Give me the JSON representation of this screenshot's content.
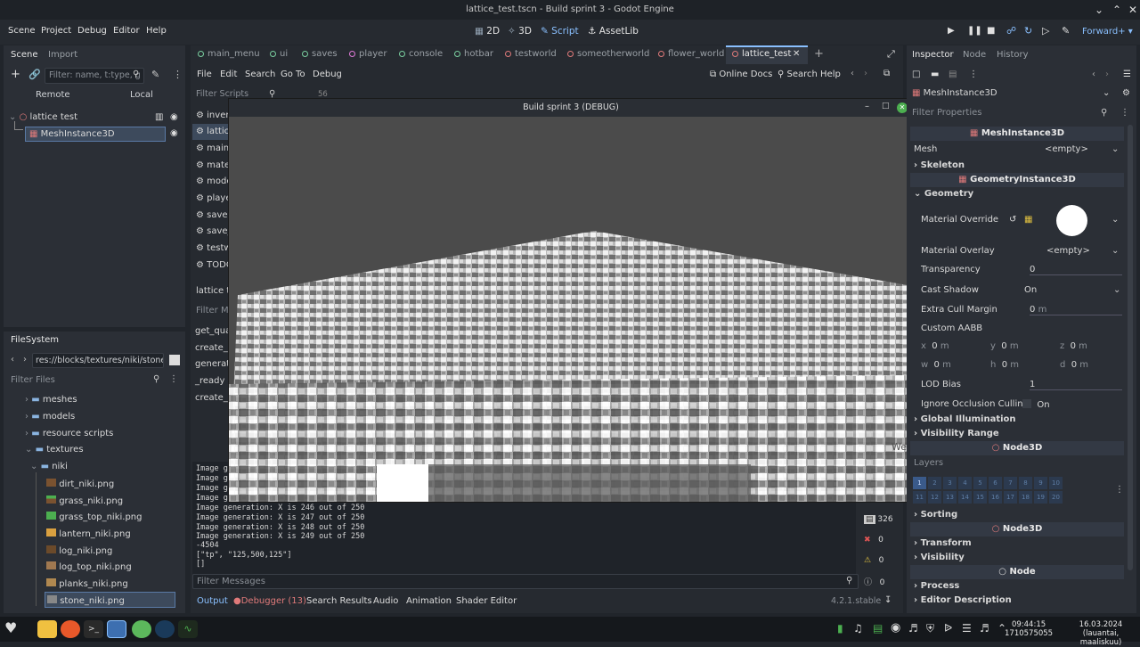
{
  "window": {
    "title": "lattice_test.tscn - Build sprint 3 - Godot Engine"
  },
  "menu": [
    "Scene",
    "Project",
    "Debug",
    "Editor",
    "Help"
  ],
  "workspaces": {
    "w2d": "2D",
    "w3d": "3D",
    "script": "Script",
    "assetlib": "AssetLib"
  },
  "renderer": "Forward+",
  "scene_tabs": [
    {
      "label": "main_menu",
      "color": "#7ad0a0"
    },
    {
      "label": "ui",
      "color": "#7ad0a0"
    },
    {
      "label": "saves",
      "color": "#7ad0a0"
    },
    {
      "label": "player",
      "color": "#e07ad8"
    },
    {
      "label": "console",
      "color": "#7ad0a0"
    },
    {
      "label": "hotbar",
      "color": "#7ad0a0"
    },
    {
      "label": "testworld",
      "color": "#e07a7a"
    },
    {
      "label": "someotherworld",
      "color": "#e07a7a"
    },
    {
      "label": "flower_world",
      "color": "#e07a7a"
    },
    {
      "label": "lattice_test",
      "color": "#e07a7a"
    }
  ],
  "scene_dock": {
    "tab_scene": "Scene",
    "tab_import": "Import",
    "filter_placeholder": "Filter: name, t:type, g",
    "remote": "Remote",
    "local": "Local",
    "root": "lattice test",
    "child": "MeshInstance3D"
  },
  "filesystem": {
    "tab": "FileSystem",
    "path": "res://blocks/textures/niki/stone_",
    "filter_placeholder": "Filter Files",
    "items": [
      {
        "label": "meshes",
        "type": "folder"
      },
      {
        "label": "models",
        "type": "folder"
      },
      {
        "label": "resource scripts",
        "type": "folder"
      },
      {
        "label": "textures",
        "type": "folder"
      },
      {
        "label": "niki",
        "type": "folder"
      },
      {
        "label": "dirt_niki.png",
        "type": "file"
      },
      {
        "label": "grass_niki.png",
        "type": "file"
      },
      {
        "label": "grass_top_niki.png",
        "type": "file"
      },
      {
        "label": "lantern_niki.png",
        "type": "file"
      },
      {
        "label": "log_niki.png",
        "type": "file"
      },
      {
        "label": "log_top_niki.png",
        "type": "file"
      },
      {
        "label": "planks_niki.png",
        "type": "file"
      },
      {
        "label": "stone_niki.png",
        "type": "file"
      }
    ]
  },
  "script_editor": {
    "menu": [
      "File",
      "Edit",
      "Search",
      "Go To",
      "Debug"
    ],
    "online_docs": "Online Docs",
    "search_help": "Search Help",
    "filter_scripts": "Filter Scripts",
    "line_no": "56",
    "scripts": [
      "inver",
      "lattic",
      "main",
      "mate",
      "mode",
      "playe",
      "saves",
      "save_",
      "testw",
      "TODO"
    ],
    "current": "lattice te",
    "filter_methods": "Filter M",
    "methods": [
      "get_qua",
      "create_l",
      "generat",
      "_ready",
      "create_v"
    ]
  },
  "output": {
    "lines": [
      "Image ge",
      "Image ge",
      "Image ge",
      "Image ge",
      "Image generation: X is 246 out of 250",
      "Image generation: X is 247 out of 250",
      "Image generation: X is 248 out of 250",
      "Image generation: X is 249 out of 250",
      "-4504",
      "[\"tp\", \"125,500,125\"]",
      "[]"
    ],
    "filter_placeholder": "Filter Messages",
    "counts": {
      "messages": "326",
      "errors": "0",
      "warnings": "0",
      "info": "0"
    }
  },
  "bottom_tabs": [
    "Output",
    "Debugger (13)",
    "Search Results",
    "Audio",
    "Animation",
    "Shader Editor"
  ],
  "version": "4.2.1.stable",
  "game_window": {
    "title": "Build sprint 3 (DEBUG)",
    "overlay_text": "Welcome to the world"
  },
  "inspector": {
    "tabs": [
      "Inspector",
      "Node",
      "History"
    ],
    "object": "MeshInstance3D",
    "filter_placeholder": "Filter Properties",
    "class_header": "MeshInstance3D",
    "mesh_label": "Mesh",
    "mesh_value": "<empty>",
    "skeleton": "Skeleton",
    "geometry_header": "GeometryInstance3D",
    "geometry": "Geometry",
    "material_override": "Material Override",
    "material_overlay": "Material Overlay",
    "material_overlay_value": "<empty>",
    "transparency": "Transparency",
    "transparency_value": "0",
    "cast_shadow": "Cast Shadow",
    "cast_shadow_value": "On",
    "extra_cull": "Extra Cull Margin",
    "extra_cull_value": "0",
    "unit_m": "m",
    "custom_aabb": "Custom AABB",
    "aabb_x": "x",
    "aabb_y": "y",
    "aabb_z": "z",
    "aabb_w": "w",
    "aabb_h": "h",
    "aabb_d": "d",
    "zero": "0",
    "lod_bias": "LOD Bias",
    "lod_bias_value": "1",
    "ignore_occlusion": "Ignore Occlusion Culling",
    "ignore_occlusion_value": "On",
    "global_illum": "Global Illumination",
    "visibility_range": "Visibility Range",
    "vi_header": "Node3D",
    "layers": "Layers",
    "layer_numbers": [
      "1",
      "2",
      "3",
      "4",
      "5",
      "6",
      "7",
      "8",
      "9",
      "10",
      "11",
      "12",
      "13",
      "14",
      "15",
      "16",
      "17",
      "18",
      "19",
      "20"
    ],
    "sorting": "Sorting",
    "node3d_header": "Node3D",
    "transform": "Transform",
    "visibility": "Visibility",
    "node_header": "Node",
    "process": "Process",
    "editor_desc": "Editor Description"
  },
  "taskbar": {
    "time": "09:44:15",
    "epoch": "1710575055",
    "date": "16.03.2024",
    "day": "(lauantai, maaliskuu)"
  }
}
